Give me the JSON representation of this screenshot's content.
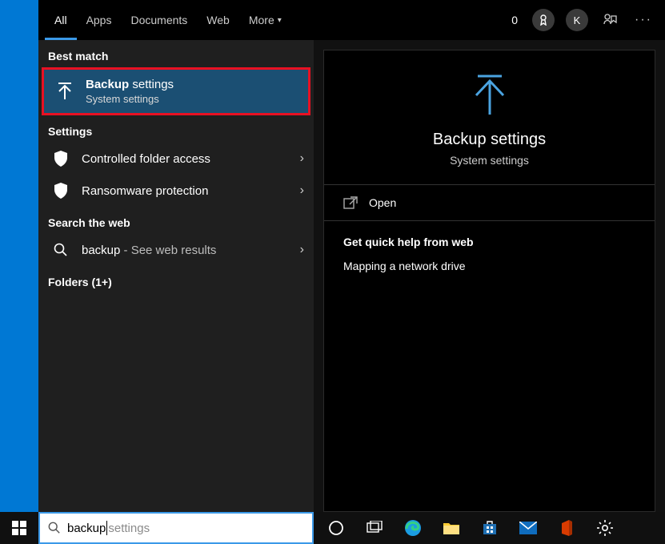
{
  "tabs": {
    "all": "All",
    "apps": "Apps",
    "documents": "Documents",
    "web": "Web",
    "more": "More",
    "active": "all"
  },
  "sections": {
    "best_match": "Best match",
    "settings": "Settings",
    "search_web": "Search the web",
    "folders": "Folders (1+)"
  },
  "best_match": {
    "title_bold": "Backup",
    "title_rest": " settings",
    "subtitle": "System settings"
  },
  "settings_items": [
    {
      "icon": "shield-icon",
      "label": "Controlled folder access"
    },
    {
      "icon": "shield-icon",
      "label": "Ransomware protection"
    }
  ],
  "web_item": {
    "query": "backup",
    "suffix": " - See web results"
  },
  "detail": {
    "title": "Backup settings",
    "subtitle": "System settings",
    "open": "Open",
    "help_heading": "Get quick help from web",
    "help_links": [
      "Mapping a network drive"
    ]
  },
  "topbar": {
    "count": "0",
    "avatar_letter": "K"
  },
  "search": {
    "typed": "backup",
    "ghost": "settings"
  },
  "taskbar_icons": [
    "cortana-icon",
    "task-view-icon",
    "edge-icon",
    "explorer-icon",
    "store-icon",
    "mail-icon",
    "office-icon",
    "settings-icon"
  ]
}
